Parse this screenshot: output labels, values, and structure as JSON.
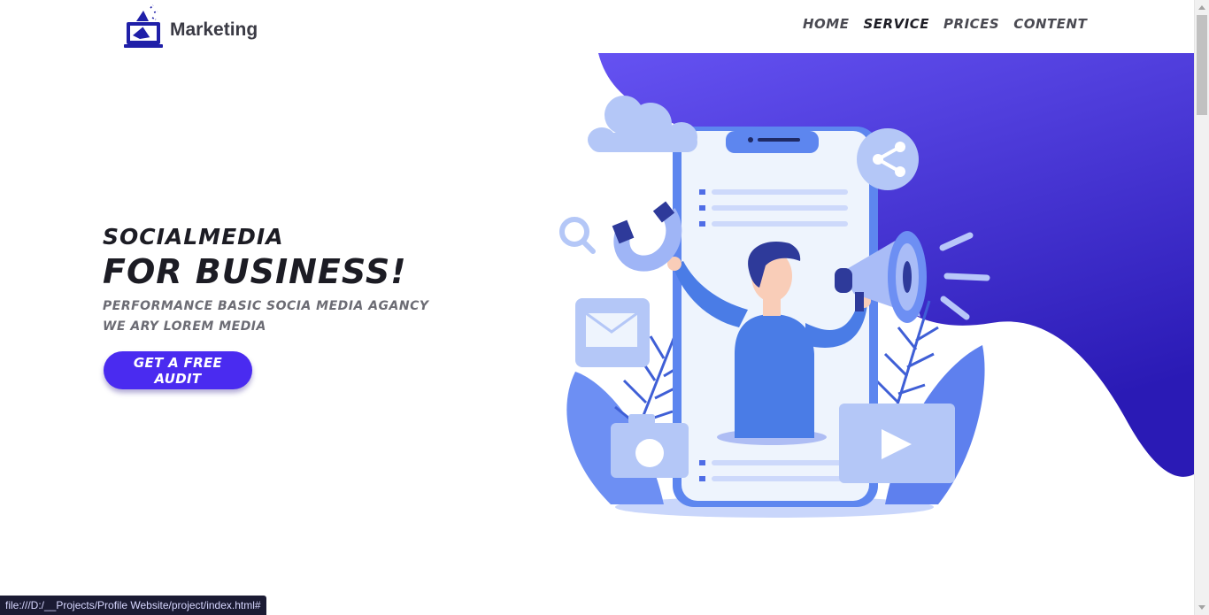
{
  "brand": {
    "name": "Marketing",
    "icon": "megaphone-laptop-logo-icon"
  },
  "nav": {
    "items": [
      {
        "label": "HOME",
        "active": false
      },
      {
        "label": "SERVICE",
        "active": true
      },
      {
        "label": "PRICES",
        "active": false
      },
      {
        "label": "CONTENT",
        "active": false
      }
    ]
  },
  "hero": {
    "line1": "SOCIALMEDIA",
    "line2": "FOR BUSINESS!",
    "sub1": "PERFORMANCE BASIC SOCIA MEDIA AGANCY",
    "sub2": "WE ARY LOREM MEDIA",
    "cta": "GET A FREE AUDIT"
  },
  "illustration": {
    "icons": [
      "cloud-icon",
      "share-icon",
      "search-icon",
      "magnet-icon",
      "megaphone-icon",
      "mail-icon",
      "camera-icon",
      "play-icon",
      "smartphone-icon",
      "person-icon",
      "leaf-icon"
    ]
  },
  "colors": {
    "accent": "#4a2bf0",
    "blob_top": "#6552f2",
    "blob_bottom": "#2a1ab5"
  },
  "status": {
    "url": "file:///D:/__Projects/Profile Website/project/index.html#"
  }
}
